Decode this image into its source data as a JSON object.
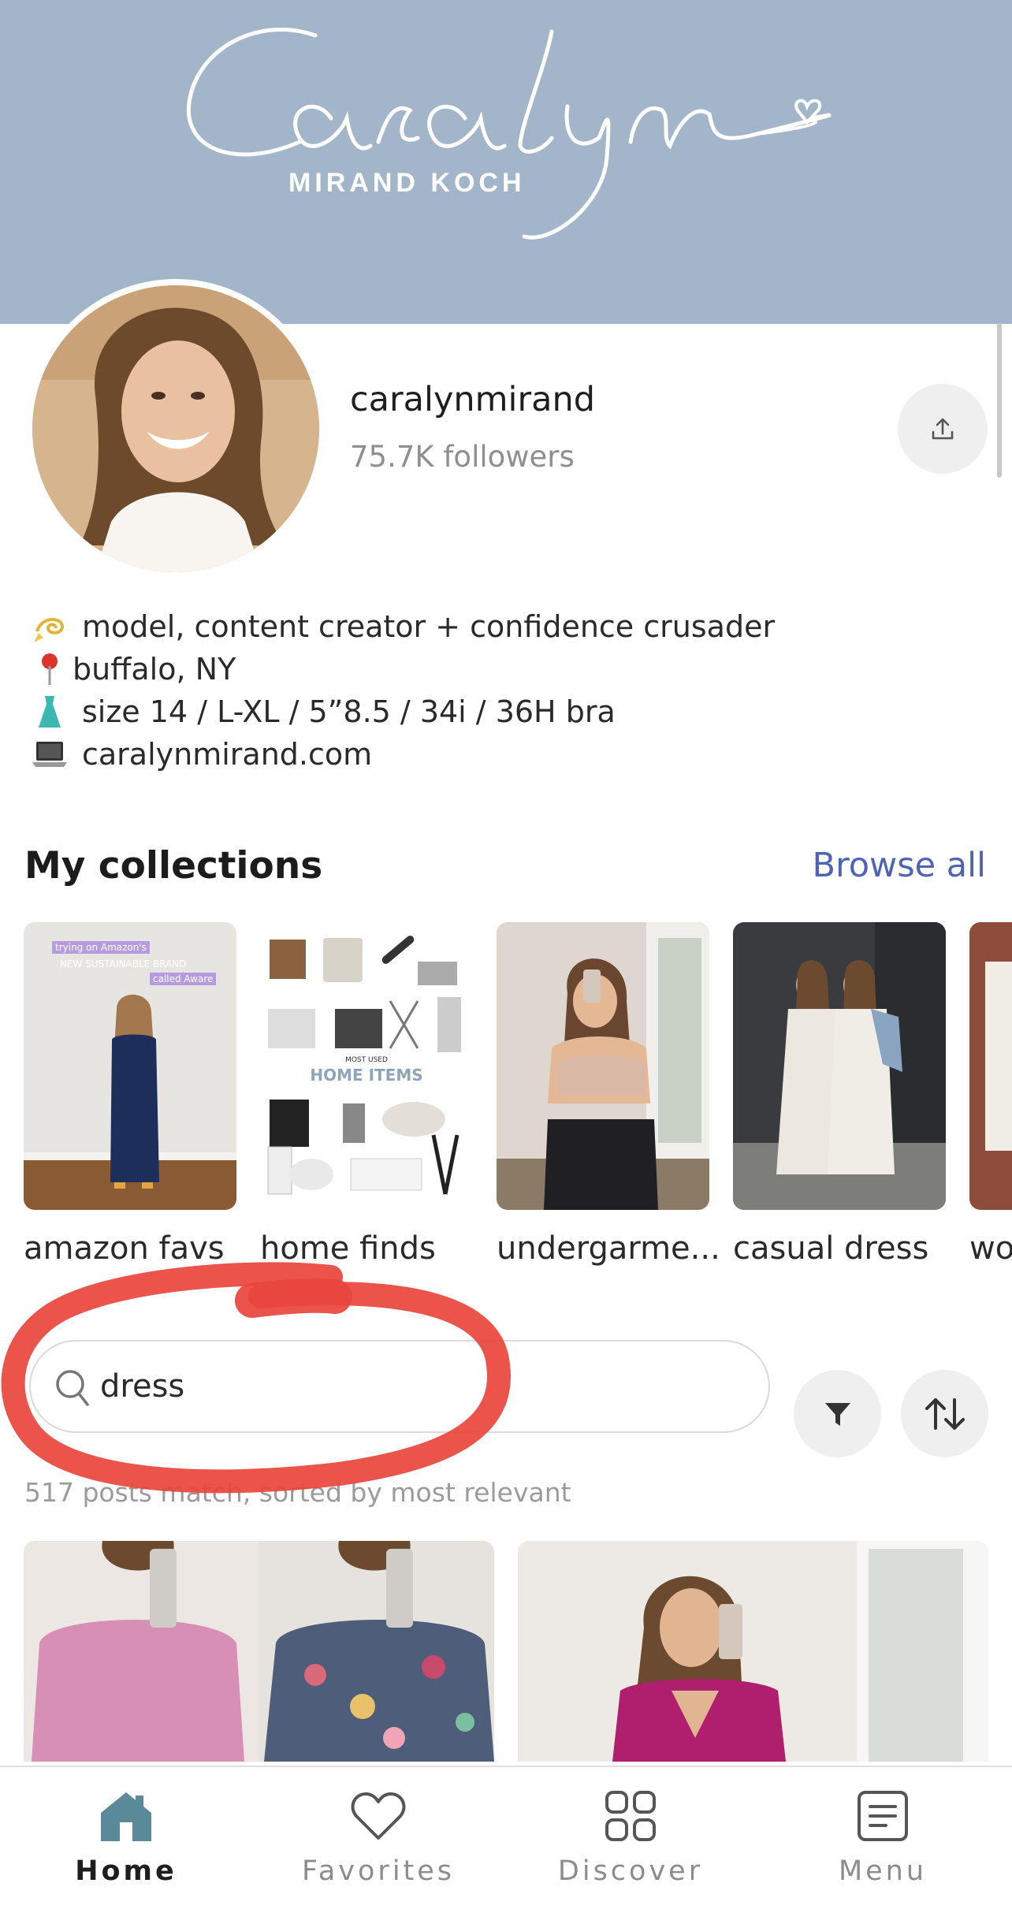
{
  "banner": {
    "script_text": "Caralyn",
    "sub_text": "MIRAND KOCH",
    "color": "#a3b6c9"
  },
  "profile": {
    "username": "caralynmirand",
    "followers": "75.7K followers",
    "share_icon": "share-upload-icon"
  },
  "bio": [
    {
      "emoji": "💫",
      "text": "model, content creator + confidence crusader"
    },
    {
      "emoji": "📍",
      "text": "buffalo, NY"
    },
    {
      "emoji": "👗",
      "text": "size 14 / L-XL / 5”8.5 / 34i / 36H bra"
    },
    {
      "emoji": "💻",
      "text": "caralynmirand.com"
    }
  ],
  "collections": {
    "title": "My collections",
    "browse_all": "Browse all",
    "items": [
      {
        "label": "amazon favs",
        "overlay_1": "trying on Amazon's",
        "overlay_2": "NEW SUSTAINABLE BRAND",
        "overlay_3": "called Aware"
      },
      {
        "label": "home finds",
        "overlay_small": "MOST USED",
        "overlay_1": "HOME ITEMS"
      },
      {
        "label": "undergarme..."
      },
      {
        "label": "casual dress"
      },
      {
        "label": "wo"
      }
    ]
  },
  "search": {
    "value": "dress",
    "filter_icon": "filter-icon",
    "sort_icon": "sort-icon",
    "result_text": "517 posts match, sorted by most relevant"
  },
  "nav": {
    "items": [
      {
        "label": "Home",
        "icon": "home-icon",
        "active": true
      },
      {
        "label": "Favorites",
        "icon": "heart-icon",
        "active": false
      },
      {
        "label": "Discover",
        "icon": "grid-icon",
        "active": false
      },
      {
        "label": "Menu",
        "icon": "menu-icon",
        "active": false
      }
    ],
    "active_color": "#5a8a9a"
  }
}
